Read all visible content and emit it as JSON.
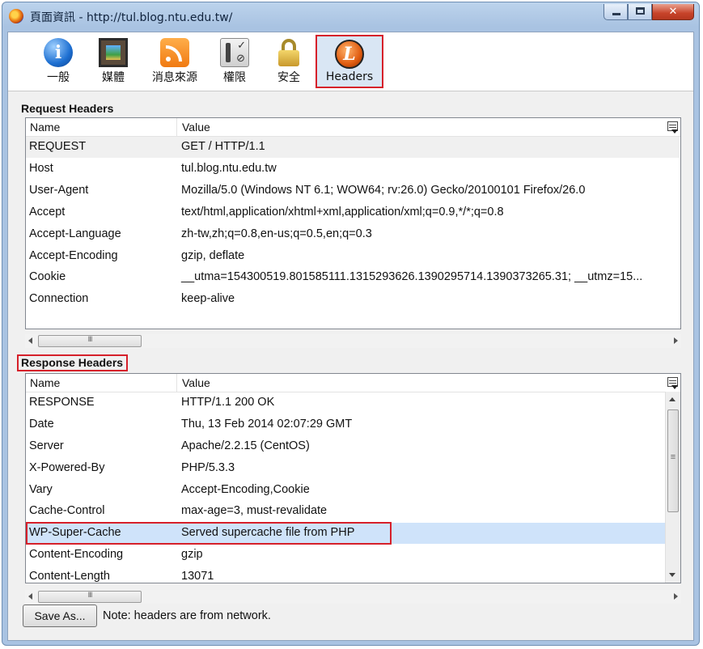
{
  "window": {
    "title": "頁面資訊 - http://tul.blog.ntu.edu.tw/",
    "controls": {
      "minimize": "–",
      "maximize": "□",
      "close": "✕"
    }
  },
  "toolbar": {
    "tabs": [
      {
        "label": "一般",
        "icon": "info-icon"
      },
      {
        "label": "媒體",
        "icon": "media-icon"
      },
      {
        "label": "消息來源",
        "icon": "rss-feed-icon"
      },
      {
        "label": "權限",
        "icon": "permissions-icon"
      },
      {
        "label": "安全",
        "icon": "lock-icon"
      },
      {
        "label": "Headers",
        "icon": "headers-icon",
        "active": true
      }
    ]
  },
  "request": {
    "section_label": "Request Headers",
    "columns": {
      "name": "Name",
      "value": "Value"
    },
    "rows": [
      {
        "name": "REQUEST",
        "value": "GET / HTTP/1.1"
      },
      {
        "name": "Host",
        "value": "tul.blog.ntu.edu.tw"
      },
      {
        "name": "User-Agent",
        "value": "Mozilla/5.0 (Windows NT 6.1; WOW64; rv:26.0) Gecko/20100101 Firefox/26.0"
      },
      {
        "name": "Accept",
        "value": "text/html,application/xhtml+xml,application/xml;q=0.9,*/*;q=0.8"
      },
      {
        "name": "Accept-Language",
        "value": "zh-tw,zh;q=0.8,en-us;q=0.5,en;q=0.3"
      },
      {
        "name": "Accept-Encoding",
        "value": "gzip, deflate"
      },
      {
        "name": "Cookie",
        "value": "__utma=154300519.801585111.1315293626.1390295714.1390373265.31; __utmz=15..."
      },
      {
        "name": "Connection",
        "value": "keep-alive"
      }
    ]
  },
  "response": {
    "section_label": "Response Headers",
    "columns": {
      "name": "Name",
      "value": "Value"
    },
    "rows": [
      {
        "name": "RESPONSE",
        "value": "HTTP/1.1 200 OK"
      },
      {
        "name": "Date",
        "value": "Thu, 13 Feb 2014 02:07:29 GMT"
      },
      {
        "name": "Server",
        "value": "Apache/2.2.15 (CentOS)"
      },
      {
        "name": "X-Powered-By",
        "value": "PHP/5.3.3"
      },
      {
        "name": "Vary",
        "value": "Accept-Encoding,Cookie"
      },
      {
        "name": "Cache-Control",
        "value": "max-age=3, must-revalidate"
      },
      {
        "name": "WP-Super-Cache",
        "value": "Served supercache file from PHP"
      },
      {
        "name": "Content-Encoding",
        "value": "gzip"
      },
      {
        "name": "Content-Length",
        "value": "13071"
      }
    ]
  },
  "footer": {
    "save_label": "Save As...",
    "note": "Note: headers are from network."
  },
  "colors": {
    "highlight_border": "#d6202a",
    "selection_blue": "#cfe3fa",
    "title_bar": "#a9c3e2"
  }
}
